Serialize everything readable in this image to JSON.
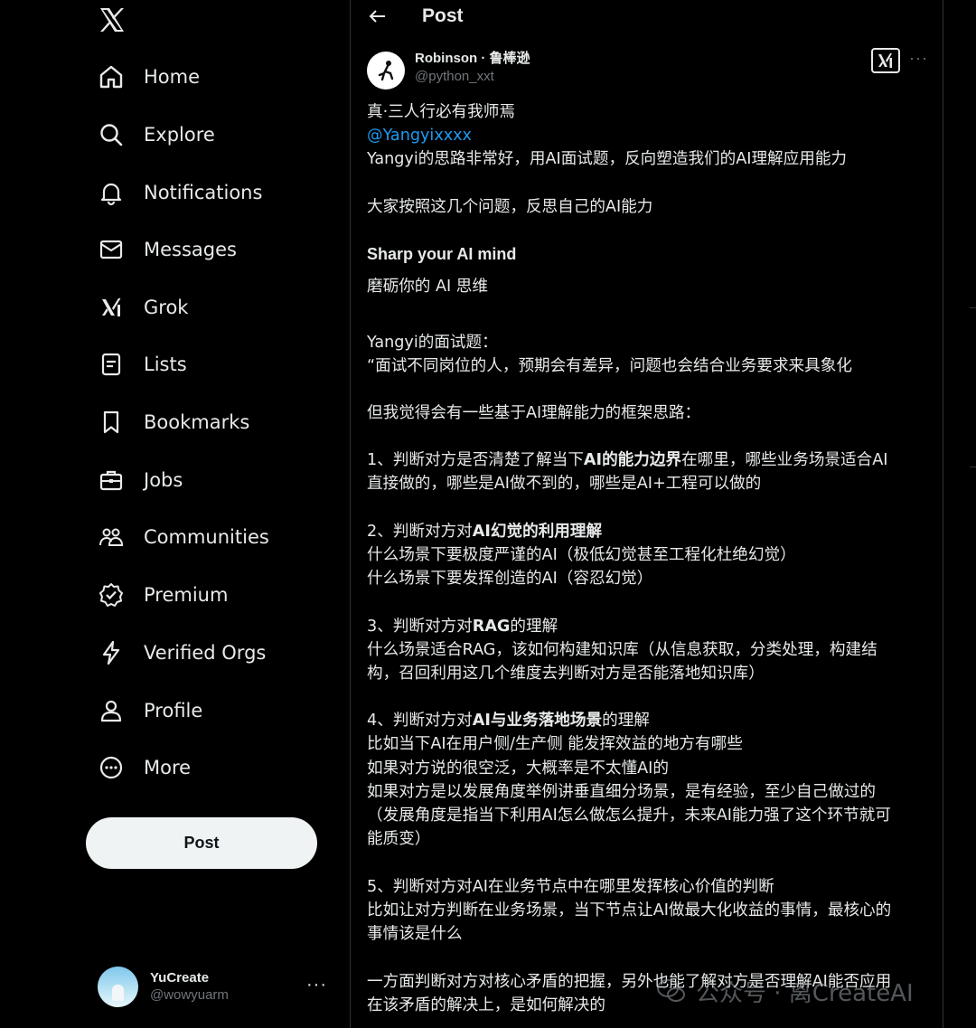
{
  "sidebar": {
    "logo": "x-logo-icon",
    "items": [
      {
        "label": "Home",
        "icon": "home-icon"
      },
      {
        "label": "Explore",
        "icon": "search-icon"
      },
      {
        "label": "Notifications",
        "icon": "bell-icon"
      },
      {
        "label": "Messages",
        "icon": "mail-icon"
      },
      {
        "label": "Grok",
        "icon": "grok-icon"
      },
      {
        "label": "Lists",
        "icon": "list-icon"
      },
      {
        "label": "Bookmarks",
        "icon": "bookmark-icon"
      },
      {
        "label": "Jobs",
        "icon": "briefcase-icon"
      },
      {
        "label": "Communities",
        "icon": "people-icon"
      },
      {
        "label": "Premium",
        "icon": "verified-badge-icon"
      },
      {
        "label": "Verified Orgs",
        "icon": "lightning-icon"
      },
      {
        "label": "Profile",
        "icon": "person-icon"
      },
      {
        "label": "More",
        "icon": "more-circle-icon"
      }
    ],
    "post_button": "Post",
    "account": {
      "name": "YuCreate",
      "handle": "@wowyuarm",
      "more": "···"
    }
  },
  "header": {
    "title": "Post",
    "back_icon": "arrow-left-icon"
  },
  "post": {
    "author_name": "Robinson · 鲁棒逊",
    "author_handle": "@python_xxt",
    "more": "···",
    "lines": {
      "l1": "真·三人行必有我师焉",
      "l2": "@Yangyixxxx",
      "l3": "Yangyi的思路非常好，用AI面试题，反向塑造我们的AI理解应用能力",
      "l4": "大家按照这几个问题，反思自己的AI能力",
      "l5": "Sharp your  AI mind",
      "l6": "磨砺你的 AI 思维",
      "l7": "Yangyi的面试题：",
      "l8": "“面试不同岗位的人，预期会有差异，问题也会结合业务要求来具象化",
      "l9": "但我觉得会有一些基于AI理解能力的框架思路：",
      "l10a": "1、判断对方是否清楚了解当下",
      "l10b": "AI的能力边界",
      "l10c": "在哪里，哪些业务场景适合AI",
      "l11": "直接做的，哪些是AI做不到的，哪些是AI+工程可以做的",
      "l12a": "2、判断对方对",
      "l12b": "AI幻觉的利用理解",
      "l13": "什么场景下要极度严谨的AI（极低幻觉甚至工程化杜绝幻觉）",
      "l14": "什么场景下要发挥创造的AI（容忍幻觉）",
      "l15a": "3、判断对方对",
      "l15b": "RAG",
      "l15c": "的理解",
      "l16": "什么场景适合RAG，该如何构建知识库（从信息获取，分类处理，构建结",
      "l17": "构，召回利用这几个维度去判断对方是否能落地知识库）",
      "l18a": "4、判断对方对",
      "l18b": "AI与业务落地场景",
      "l18c": "的理解",
      "l19": "比如当下AI在用户侧/生产侧 能发挥效益的地方有哪些",
      "l20": "如果对方说的很空泛，大概率是不太懂AI的",
      "l21": "如果对方是以发展角度举例讲垂直细分场景，是有经验，至少自己做过的",
      "l22": "（发展角度是指当下利用AI怎么做怎么提升，未来AI能力强了这个环节就可",
      "l23": "能质变）",
      "l24": "5、判断对方对AI在业务节点中在哪里发挥核心价值的判断",
      "l25": "比如让对方判断在业务场景，当下节点让AI做最大化收益的事情，最核心的",
      "l26": "事情该是什么",
      "l27": "一方面判断对方对核心矛盾的把握，另外也能了解对方是否理解AI能否应用",
      "l28": "在该矛盾的解决上，是如何解决的"
    }
  },
  "watermark": {
    "text": "公众号 · 离CreateAI"
  }
}
